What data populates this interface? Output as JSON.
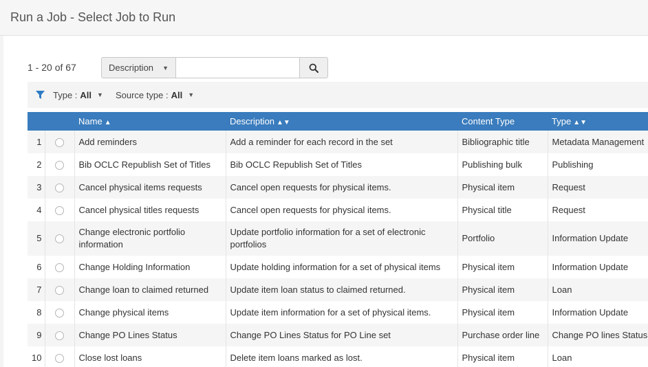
{
  "page": {
    "title": "Run a Job - Select Job to Run"
  },
  "results": {
    "count": "1 - 20 of 67"
  },
  "search": {
    "scope": "Description",
    "value": "",
    "placeholder": ""
  },
  "filters": [
    {
      "label": "Type :",
      "value": "All"
    },
    {
      "label": "Source type :",
      "value": "All"
    }
  ],
  "table": {
    "columns": {
      "name": "Name",
      "description": "Description",
      "content_type": "Content Type",
      "type": "Type"
    },
    "sort_icons": {
      "name": "▲",
      "description": "▲▼",
      "type": "▲▼"
    },
    "rows": [
      {
        "num": "1",
        "name": "Add reminders",
        "description": "Add a reminder for each record in the set",
        "content_type": "Bibliographic title",
        "type": "Metadata Management"
      },
      {
        "num": "2",
        "name": "Bib OCLC Republish Set of Titles",
        "description": "Bib OCLC Republish Set of Titles",
        "content_type": "Publishing bulk",
        "type": "Publishing"
      },
      {
        "num": "3",
        "name": "Cancel physical items requests",
        "description": "Cancel open requests for physical items.",
        "content_type": "Physical item",
        "type": "Request"
      },
      {
        "num": "4",
        "name": "Cancel physical titles requests",
        "description": "Cancel open requests for physical items.",
        "content_type": "Physical title",
        "type": "Request"
      },
      {
        "num": "5",
        "name": "Change electronic portfolio information",
        "description": "Update portfolio information for a set of electronic portfolios",
        "content_type": "Portfolio",
        "type": "Information Update"
      },
      {
        "num": "6",
        "name": "Change Holding Information",
        "description": "Update holding information for a set of physical items",
        "content_type": "Physical item",
        "type": "Information Update"
      },
      {
        "num": "7",
        "name": "Change loan to claimed returned",
        "description": "Update item loan status to claimed returned.",
        "content_type": "Physical item",
        "type": "Loan"
      },
      {
        "num": "8",
        "name": "Change physical items",
        "description": "Update item information for a set of physical items.",
        "content_type": "Physical item",
        "type": "Information Update"
      },
      {
        "num": "9",
        "name": "Change PO Lines Status",
        "description": "Change PO Lines Status for PO Line set",
        "content_type": "Purchase order line",
        "type": "Change PO lines Status"
      },
      {
        "num": "10",
        "name": "Close lost loans",
        "description": "Delete item loans marked as lost.",
        "content_type": "Physical item",
        "type": "Loan"
      }
    ]
  },
  "colors": {
    "header_blue": "#3a7cbd",
    "filter_icon": "#2e7bc4"
  }
}
